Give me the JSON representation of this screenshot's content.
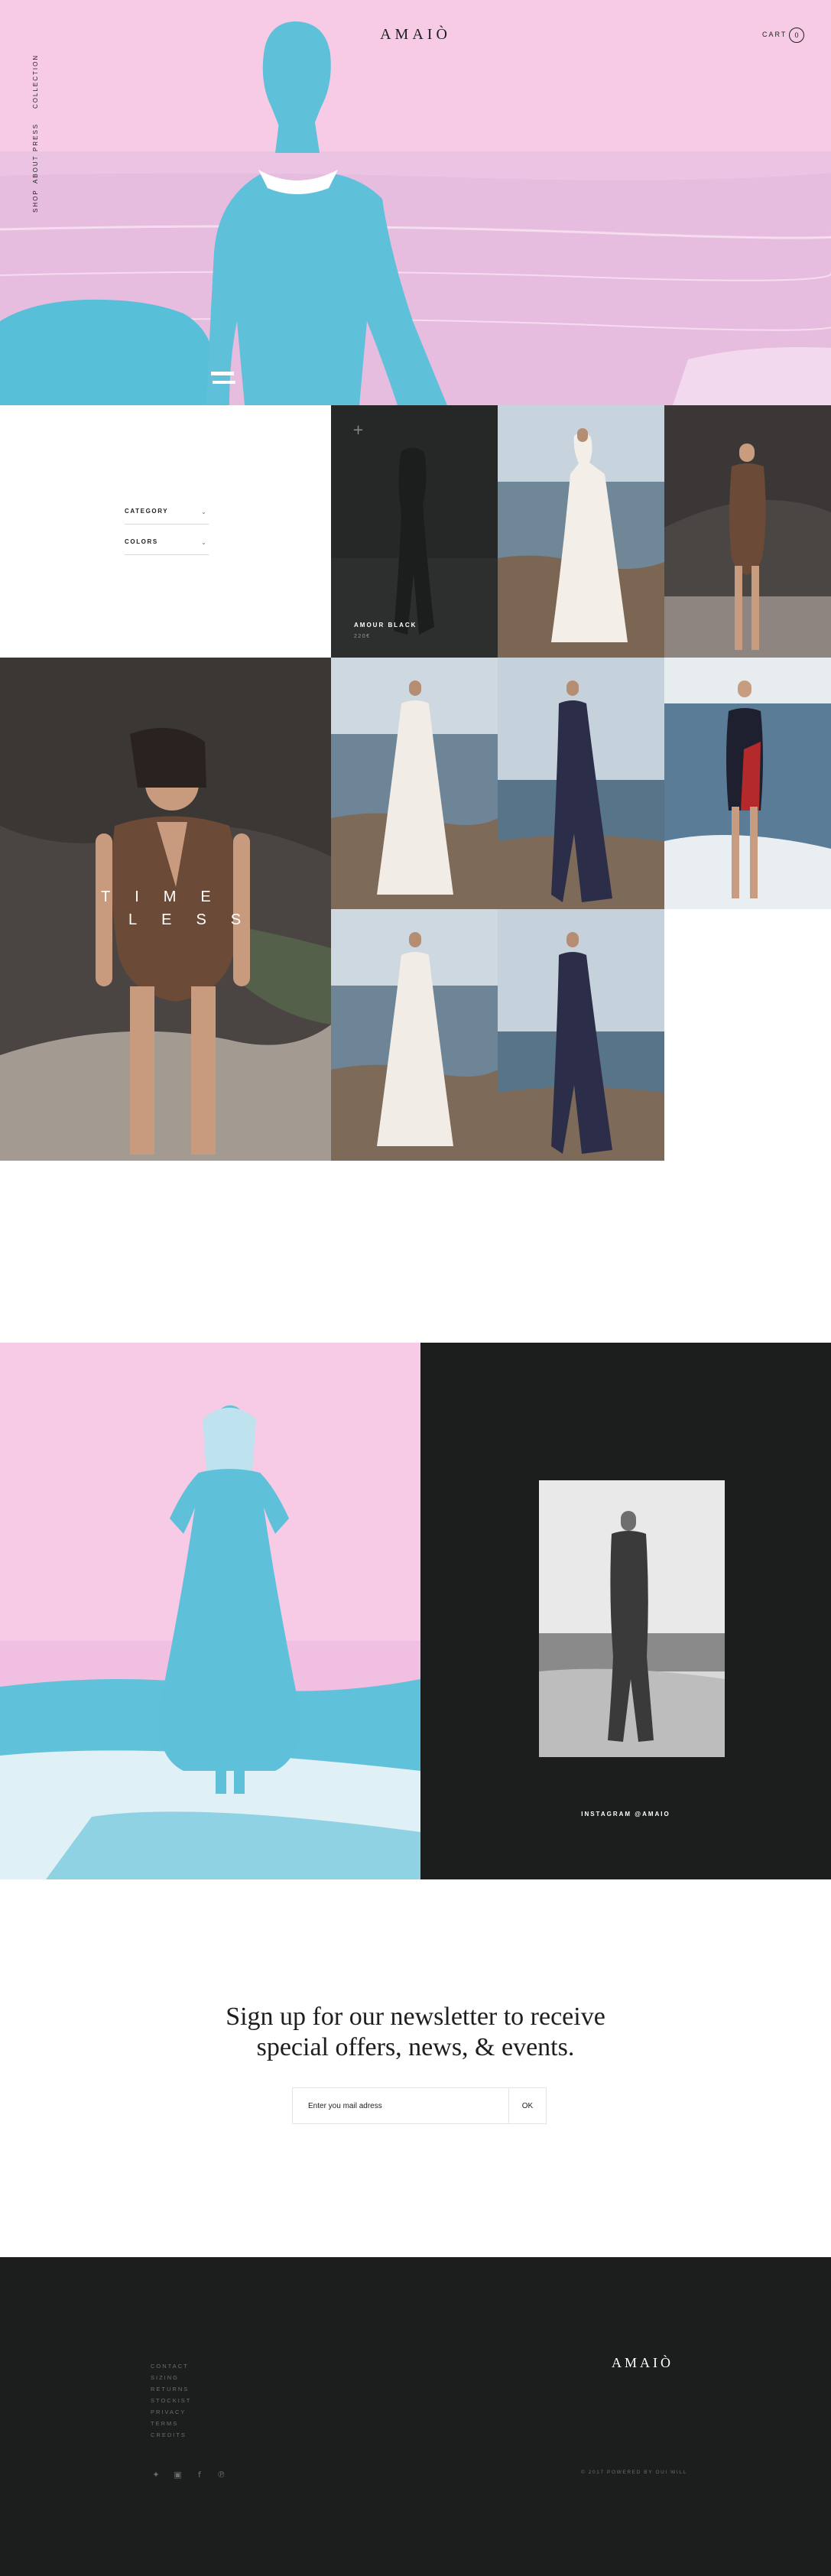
{
  "header": {
    "logo": "AMAIÒ",
    "nav": [
      "COLLECTION",
      "PRESS",
      "ABOUT",
      "SHOP"
    ],
    "cart_label": "CART",
    "cart_count": "0"
  },
  "filters": [
    {
      "label": "CATEGORY",
      "chevron": "chevron-down-icon"
    },
    {
      "label": "COLORS",
      "chevron": "chevron-down-icon"
    }
  ],
  "products": {
    "featured": {
      "name": "AMOUR BLACK",
      "price": "220€"
    },
    "overlay_text": {
      "line1": "TIME",
      "line2": "LESS"
    }
  },
  "instagram": {
    "label": "INSTAGRAM @AMAIO"
  },
  "newsletter": {
    "title_line1": "Sign up for our newsletter to receive",
    "title_line2": "special offers, news, & events.",
    "placeholder": "Enter you mail adress",
    "button": "OK"
  },
  "footer": {
    "logo": "AMAIÒ",
    "links": [
      "CONTACT",
      "SIZING",
      "RETURNS",
      "STOCKIST",
      "PRIVACY",
      "TERMS",
      "CREDITS"
    ],
    "socials": [
      "twitter-icon",
      "instagram-icon",
      "facebook-icon",
      "pinterest-icon"
    ],
    "copyright": "© 2017 POWERED BY OUI WILL"
  },
  "colors": {
    "pink": "#f7cbe6",
    "cyan": "#5ec1d9",
    "dark": "#1c1e1d"
  }
}
